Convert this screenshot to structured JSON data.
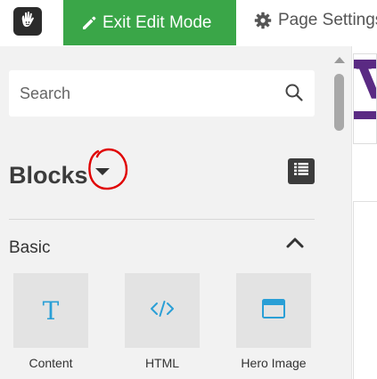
{
  "toolbar": {
    "exit_edit_label": "Exit Edit Mode",
    "page_settings_label": "Page Settings",
    "logo_icon": "concrete-hand-icon",
    "colors": {
      "exit_button": "#3aa648"
    }
  },
  "panel": {
    "search": {
      "placeholder": "Search",
      "value": ""
    },
    "title": "Blocks",
    "section_label": "Basic",
    "annotation_color": "#e00000",
    "blocks": [
      {
        "label": "Content",
        "icon": "text-t-icon"
      },
      {
        "label": "HTML",
        "icon": "code-icon"
      },
      {
        "label": "Hero Image",
        "icon": "window-icon"
      }
    ]
  }
}
